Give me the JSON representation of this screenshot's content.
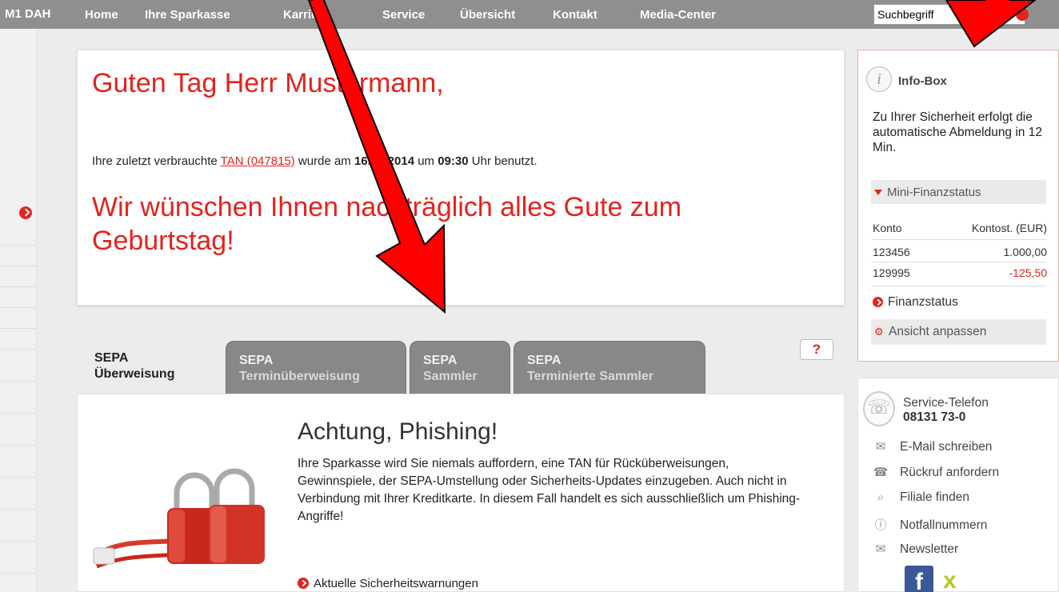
{
  "topnav": {
    "brand": "M1 DAH",
    "items": [
      "Home",
      "Ihre Sparkasse",
      "Karriere",
      "Service",
      "Übersicht",
      "Kontakt",
      "Media-Center"
    ],
    "search_value": "Suchbegriff"
  },
  "greeting": {
    "title": "Guten Tag Herr Mustermann,",
    "tan_prefix": "Ihre zuletzt verbrauchte ",
    "tan_link": "TAN (047815)",
    "tan_mid": " wurde am ",
    "tan_date": "16.03.2014",
    "tan_um": " um ",
    "tan_time": "09:30",
    "tan_suffix": " Uhr benutzt.",
    "birthday": "Wir wünschen Ihnen nachträglich alles Gute zum Geburtstag!"
  },
  "tabs": [
    {
      "line1": "SEPA",
      "line2": "Überweisung"
    },
    {
      "line1": "SEPA",
      "line2": "Terminüberweisung"
    },
    {
      "line1": "SEPA",
      "line2": "Sammler"
    },
    {
      "line1": "SEPA",
      "line2": "Terminierte Sammler"
    }
  ],
  "help_label": "?",
  "phishing": {
    "title": "Achtung, Phishing!",
    "text": "Ihre Sparkasse wird Sie niemals auffordern, eine TAN für Rücküberweisungen, Gewinnspiele, der SEPA-Umstellung oder Sicherheits-Updates einzugeben. Auch nicht in Verbindung mit Ihrer Kreditkarte. In diesem Fall handelt es sich ausschließlich um Phishing-Angriffe!",
    "link": "Aktuelle Sicherheitswarnungen"
  },
  "infobox": {
    "icon_letter": "i",
    "title": "Info-Box",
    "text": "Zu Ihrer Sicherheit erfolgt die automatische Abmeldung in 12 Min.",
    "mini_title": "Mini-Finanzstatus",
    "col_konto": "Konto",
    "col_kontostand": "Kontost. (EUR)",
    "rows": [
      {
        "konto": "123456",
        "saldo": "1.000,00"
      },
      {
        "konto": "129995",
        "saldo": "-125,50"
      }
    ],
    "finanzstatus": "Finanzstatus",
    "ansicht": "Ansicht anpassen"
  },
  "service": {
    "label": "Service-Telefon",
    "number": "08131 73-0",
    "items": [
      "E-Mail schreiben",
      "Rückruf anfordern",
      "Filiale finden",
      "Notfallnummern",
      "Newsletter"
    ]
  },
  "social": {
    "facebook": "f",
    "xing": "x"
  },
  "colors": {
    "brand_red": "#e3231c",
    "nav_gray": "#8f8f8f",
    "arrow_red": "#ff0000"
  },
  "icons": [
    "search-icon",
    "arrow-right-icon",
    "info-icon",
    "phone-icon",
    "mail-icon",
    "callback-icon",
    "magnifier-icon",
    "emergency-icon",
    "newsletter-icon",
    "facebook-icon",
    "xing-icon",
    "lock-icon"
  ]
}
